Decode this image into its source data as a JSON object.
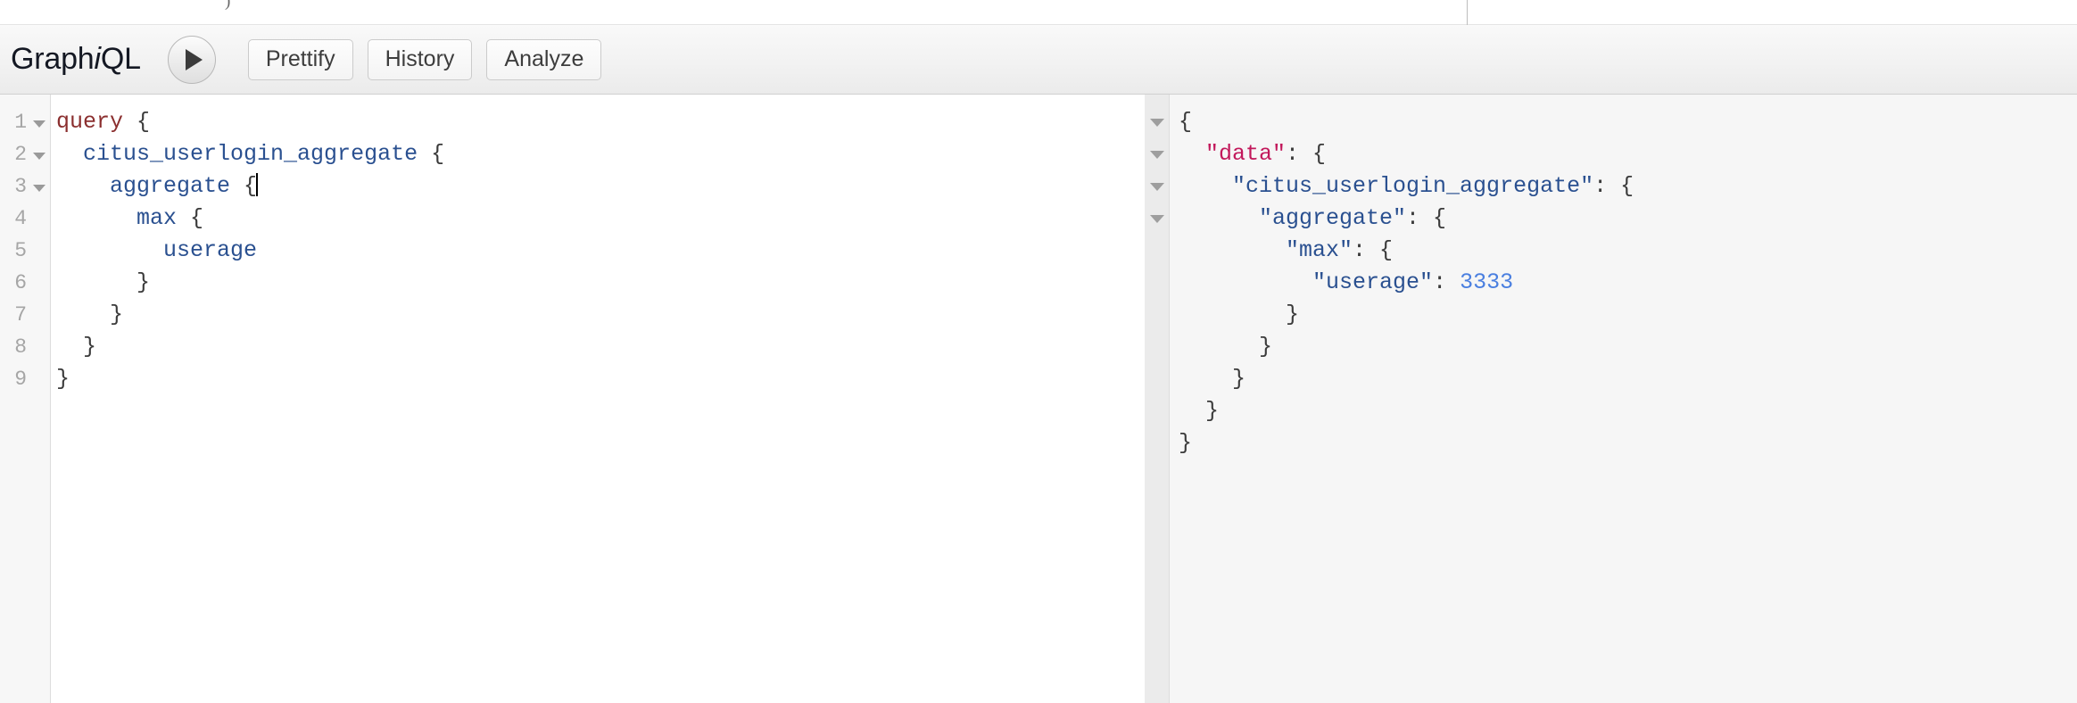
{
  "top_strip": {
    "ghost_text": ")"
  },
  "toolbar": {
    "brand_prefix": "Graph",
    "brand_italic": "i",
    "brand_suffix": "QL",
    "run_button_label": "execute-query",
    "buttons": [
      {
        "label": "Prettify"
      },
      {
        "label": "History"
      },
      {
        "label": "Analyze"
      }
    ]
  },
  "editor": {
    "line_numbers": [
      "1",
      "2",
      "3",
      "4",
      "5",
      "6",
      "7",
      "8",
      "9"
    ],
    "foldable_lines": [
      1,
      2,
      3
    ],
    "lines": [
      {
        "indent": "",
        "keyword": "query",
        "field": "",
        "brace": " {"
      },
      {
        "indent": "  ",
        "keyword": "",
        "field": "citus_userlogin_aggregate",
        "brace": " {"
      },
      {
        "indent": "    ",
        "keyword": "",
        "field": "aggregate",
        "brace": " {"
      },
      {
        "indent": "      ",
        "keyword": "",
        "field": "max",
        "brace": " {"
      },
      {
        "indent": "        ",
        "keyword": "",
        "field": "userage",
        "brace": ""
      },
      {
        "indent": "      ",
        "keyword": "",
        "field": "",
        "brace": "}"
      },
      {
        "indent": "    ",
        "keyword": "",
        "field": "",
        "brace": "}"
      },
      {
        "indent": "  ",
        "keyword": "",
        "field": "",
        "brace": "}"
      },
      {
        "indent": "",
        "keyword": "",
        "field": "",
        "brace": "}"
      }
    ],
    "cursor_line": 3
  },
  "result": {
    "fold_arrow_count": 4,
    "lines": [
      {
        "indent": "",
        "key": "",
        "kind": "punc",
        "after": "{"
      },
      {
        "indent": "  ",
        "key": "\"data\"",
        "kind": "data",
        "after": ": {"
      },
      {
        "indent": "    ",
        "key": "\"citus_userlogin_aggregate\"",
        "kind": "key",
        "after": ": {"
      },
      {
        "indent": "      ",
        "key": "\"aggregate\"",
        "kind": "key",
        "after": ": {"
      },
      {
        "indent": "        ",
        "key": "\"max\"",
        "kind": "key",
        "after": ": {"
      },
      {
        "indent": "          ",
        "key": "\"userage\"",
        "kind": "key",
        "after": ": ",
        "value": "3333"
      },
      {
        "indent": "        ",
        "key": "",
        "kind": "punc",
        "after": "}"
      },
      {
        "indent": "      ",
        "key": "",
        "kind": "punc",
        "after": "}"
      },
      {
        "indent": "    ",
        "key": "",
        "kind": "punc",
        "after": "}"
      },
      {
        "indent": "  ",
        "key": "",
        "kind": "punc",
        "after": "}"
      },
      {
        "indent": "",
        "key": "",
        "kind": "punc",
        "after": "}"
      }
    ]
  },
  "colors": {
    "keyword": "#8b2f2f",
    "field": "#2a5090",
    "data_key": "#c2185b",
    "number": "#4a7fe0",
    "toolbar_bg": "#f2f2f2",
    "result_bg": "#f6f6f6"
  }
}
